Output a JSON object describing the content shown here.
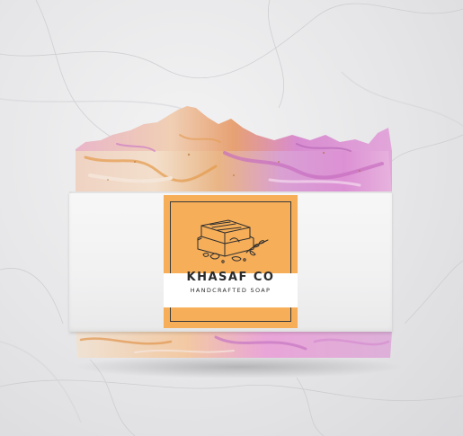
{
  "label": {
    "brand_name": "KHASAF CO",
    "tagline": "HANDCRAFTED SOAP",
    "illustration_icon": "soap-bar-with-botanicals-sketch"
  },
  "colors": {
    "label_background": "#f6ae59",
    "soap_pink": "#d98bd0",
    "soap_orange": "#e9a04c",
    "soap_cream": "#f2e4d2",
    "marble_background": "#e6e6e8"
  }
}
